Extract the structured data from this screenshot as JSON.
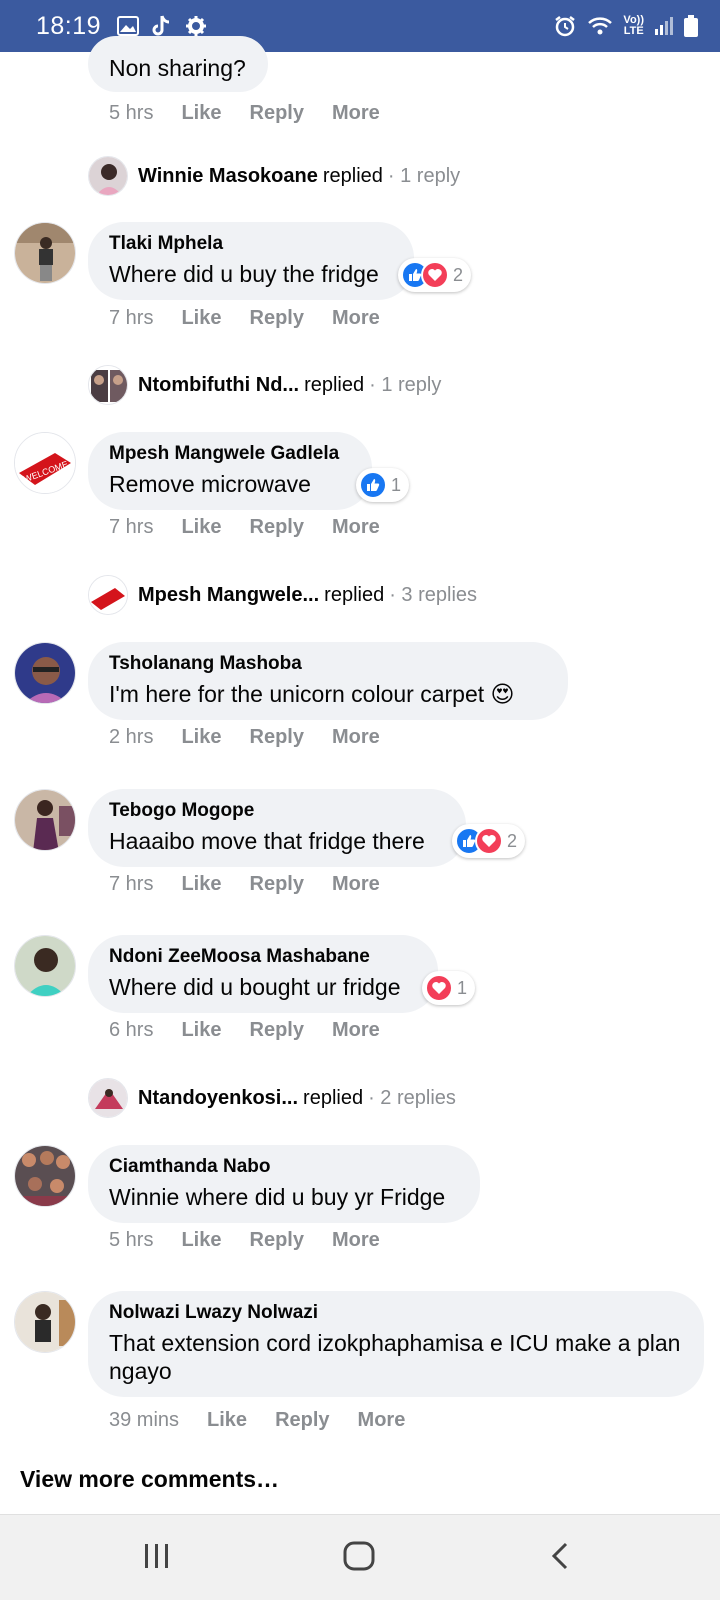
{
  "status_bar": {
    "time": "18:19",
    "lte_top": "Vo))",
    "lte_bottom": "LTE"
  },
  "truncated_top": {
    "text": "Non sharing?",
    "time": "5 hrs"
  },
  "actions": {
    "like": "Like",
    "reply": "Reply",
    "more": "More"
  },
  "replied_rows": [
    {
      "name": "Winnie Masokoane",
      "verb": "replied",
      "count": "· 1 reply"
    },
    {
      "name": "Ntombifuthi Nd...",
      "verb": "replied",
      "count": "· 1 reply"
    },
    {
      "name": "Mpesh Mangwele...",
      "verb": "replied",
      "count": "· 3 replies"
    },
    {
      "name": "Ntandoyenkosi...",
      "verb": "replied",
      "count": "· 2 replies"
    }
  ],
  "comments": [
    {
      "author": "Tlaki Mphela",
      "text": "Where did u buy the fridge",
      "time": "7 hrs",
      "reaction_count": "2"
    },
    {
      "author": "Mpesh Mangwele Gadlela",
      "text": "Remove microwave",
      "time": "7 hrs",
      "reaction_count": "1"
    },
    {
      "author": "Tsholanang Mashoba",
      "text": "I'm here for the unicorn colour carpet 😍",
      "time": "2 hrs"
    },
    {
      "author": "Tebogo Mogope",
      "text": "Haaaibo move that fridge there",
      "time": "7 hrs",
      "reaction_count": "2"
    },
    {
      "author": "Ndoni ZeeMoosa Mashabane",
      "text": "Where did u bought ur fridge",
      "time": "6 hrs",
      "reaction_count": "1"
    },
    {
      "author": "Ciamthanda Nabo",
      "text": "Winnie where did u buy yr Fridge",
      "time": "5 hrs"
    },
    {
      "author": "Nolwazi Lwazy Nolwazi",
      "text": "That extension cord izokphaphamisa e ICU make a plan ngayo",
      "time": "39 mins"
    }
  ],
  "view_more": "View more comments…",
  "colors": {
    "status_bar": "#3b5a9f",
    "bubble": "#f0f2f5",
    "like": "#1877f2",
    "love": "#f33e58",
    "meta": "#8a8d91"
  }
}
